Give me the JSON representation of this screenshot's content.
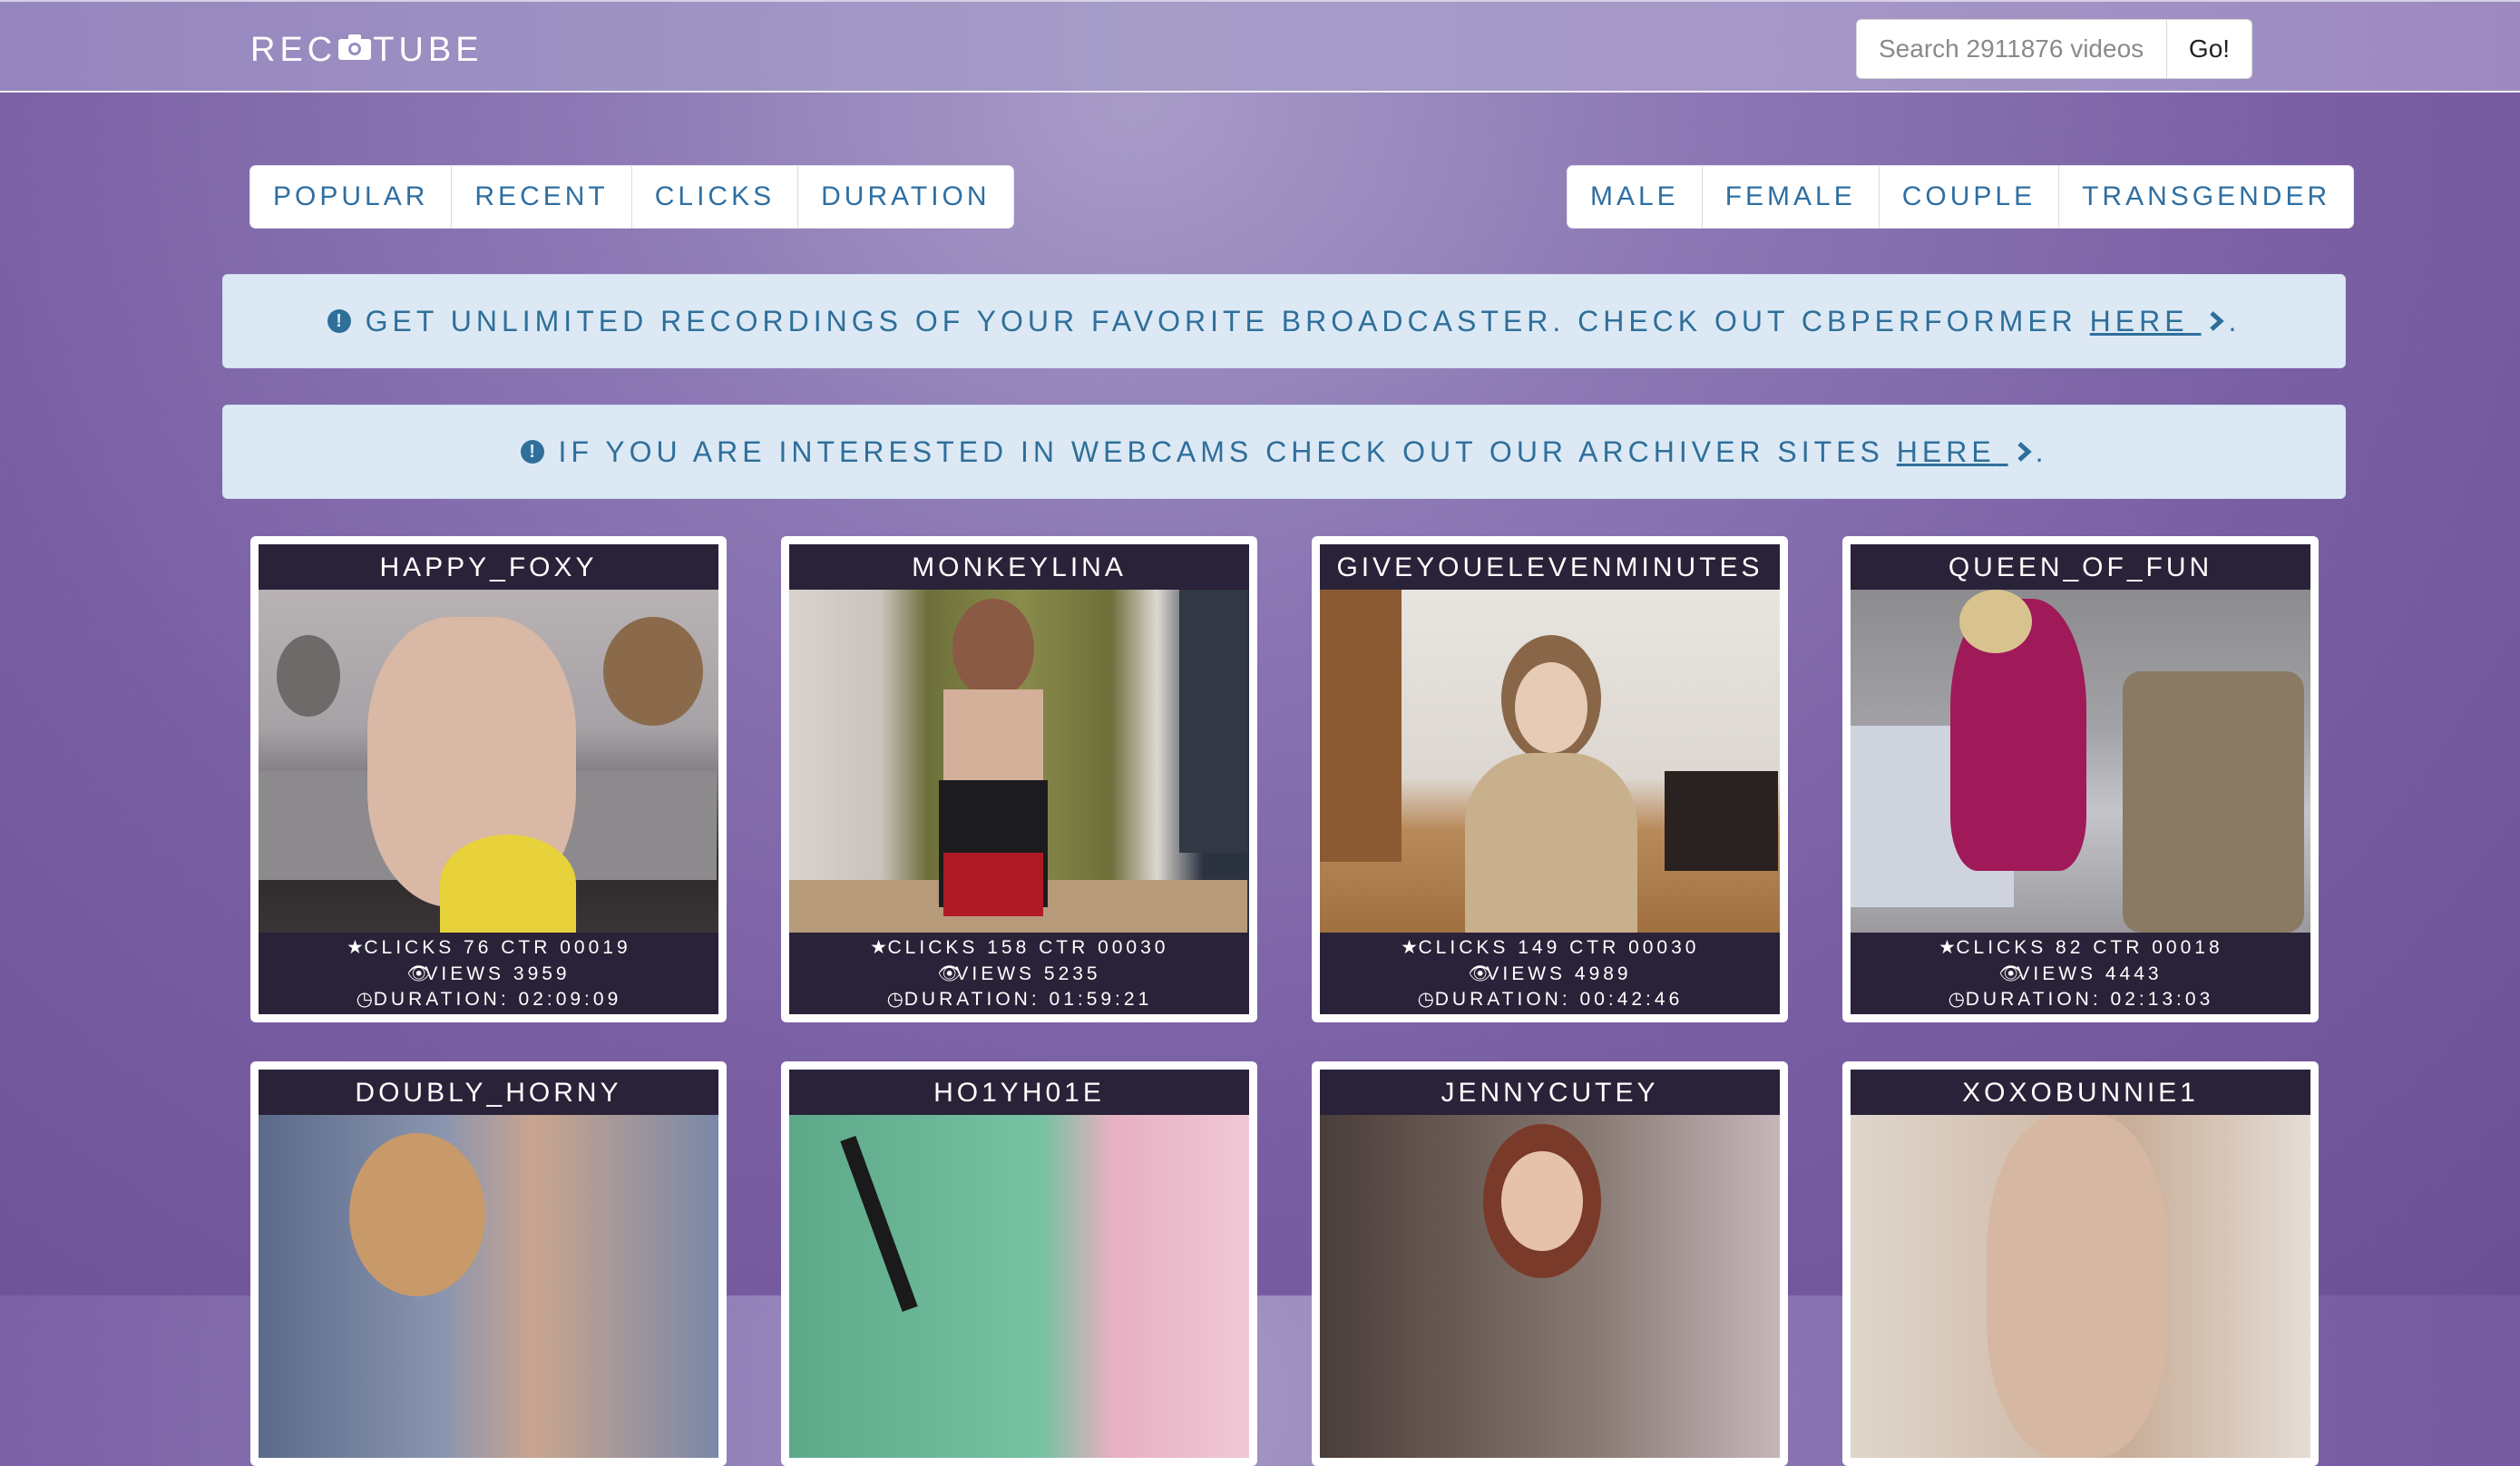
{
  "header": {
    "logo_left": "REC",
    "logo_right": "TUBE",
    "search_placeholder": "Search 2911876 videos",
    "search_button": "Go!"
  },
  "sort_tabs": [
    "POPULAR",
    "RECENT",
    "CLICKS",
    "DURATION"
  ],
  "gender_tabs": [
    "MALE",
    "FEMALE",
    "COUPLE",
    "TRANSGENDER"
  ],
  "alerts": [
    {
      "text": "GET UNLIMITED RECORDINGS OF YOUR FAVORITE BROADCASTER. CHECK OUT CBPERFORMER",
      "link": "HERE",
      "end": "."
    },
    {
      "text": "IF YOU ARE INTERESTED IN WEBCAMS CHECK OUT OUR ARCHIVER SITES",
      "link": "HERE",
      "end": "."
    }
  ],
  "videos": [
    {
      "name": "HAPPY_FOXY",
      "clicks": "CLICKS 76 CTR 00019",
      "views": "VIEWS 3959",
      "duration": "DURATION: 02:09:09"
    },
    {
      "name": "MONKEYLINA",
      "clicks": "CLICKS 158 CTR 00030",
      "views": "VIEWS 5235",
      "duration": "DURATION: 01:59:21"
    },
    {
      "name": "GIVEYOUELEVENMINUTES",
      "clicks": "CLICKS 149 CTR 00030",
      "views": "VIEWS 4989",
      "duration": "DURATION: 00:42:46"
    },
    {
      "name": "QUEEN_OF_FUN",
      "clicks": "CLICKS 82 CTR 00018",
      "views": "VIEWS 4443",
      "duration": "DURATION: 02:13:03"
    },
    {
      "name": "DOUBLY_HORNY"
    },
    {
      "name": "HO1YH01E"
    },
    {
      "name": "JENNYCUTEY"
    },
    {
      "name": "XOXOBUNNIE1"
    }
  ],
  "icons": {
    "logo": "camera-icon",
    "alert": "exclamation-circle-icon",
    "link": "chevron-right-icon",
    "clicks": "star-icon",
    "views": "eye-icon",
    "duration": "clock-icon"
  },
  "colors": {
    "link_blue": "#2f6fa2",
    "alert_bg": "#dce9f5",
    "card_dark": "#2a2238"
  }
}
